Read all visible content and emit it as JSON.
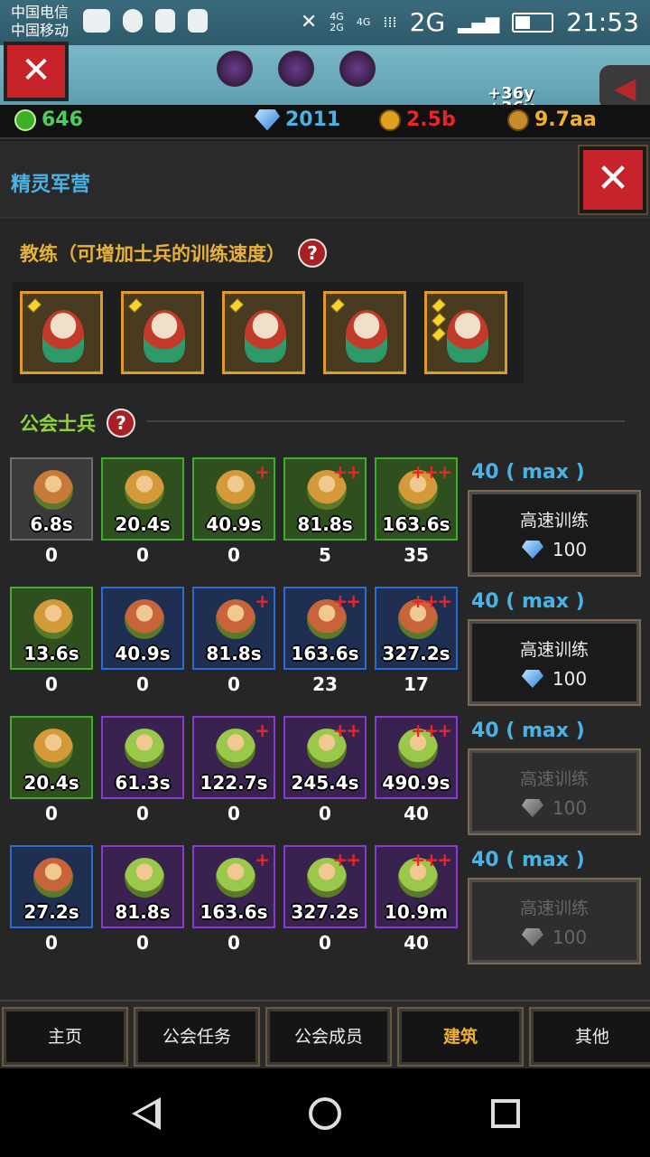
{
  "status_bar": {
    "carrier_1": "中国电信",
    "carrier_2": "中国移动",
    "network_4g_top": "4G",
    "network_4g_2g": "4G",
    "network_2g_small": "2G",
    "network_2g": "2G",
    "time": "21:53"
  },
  "resources": {
    "gems_green": "646",
    "diamonds": "2011",
    "medal": "2.5b",
    "coins": "9.7aa",
    "gain_1": "+36y",
    "gain_2": "+36y"
  },
  "panel": {
    "title": "精灵军营",
    "coach_section_title": "教练（可增加士兵的训练速度）",
    "guild_section_title": "公会士兵",
    "help_glyph": "?",
    "close_glyph": "✕"
  },
  "coaches": [
    {
      "gems": 1
    },
    {
      "gems": 1
    },
    {
      "gems": 1
    },
    {
      "gems": 1
    },
    {
      "gems": 3
    }
  ],
  "soldier_rows": [
    {
      "max_label": "40 ( max )",
      "train_label": "高速训练",
      "train_cost": "100",
      "enabled": true,
      "units": [
        {
          "time": "6.8s",
          "count": "0",
          "plus": "",
          "tier": "gray"
        },
        {
          "time": "20.4s",
          "count": "0",
          "plus": "",
          "tier": "green"
        },
        {
          "time": "40.9s",
          "count": "0",
          "plus": "+",
          "tier": "green"
        },
        {
          "time": "81.8s",
          "count": "5",
          "plus": "++",
          "tier": "green"
        },
        {
          "time": "163.6s",
          "count": "35",
          "plus": "+++",
          "tier": "green"
        }
      ]
    },
    {
      "max_label": "40 ( max )",
      "train_label": "高速训练",
      "train_cost": "100",
      "enabled": true,
      "units": [
        {
          "time": "13.6s",
          "count": "0",
          "plus": "",
          "tier": "green"
        },
        {
          "time": "40.9s",
          "count": "0",
          "plus": "",
          "tier": "blue"
        },
        {
          "time": "81.8s",
          "count": "0",
          "plus": "+",
          "tier": "blue"
        },
        {
          "time": "163.6s",
          "count": "23",
          "plus": "++",
          "tier": "blue"
        },
        {
          "time": "327.2s",
          "count": "17",
          "plus": "+++",
          "tier": "blue"
        }
      ]
    },
    {
      "max_label": "40 ( max )",
      "train_label": "高速训练",
      "train_cost": "100",
      "enabled": false,
      "units": [
        {
          "time": "20.4s",
          "count": "0",
          "plus": "",
          "tier": "green"
        },
        {
          "time": "61.3s",
          "count": "0",
          "plus": "",
          "tier": "purple"
        },
        {
          "time": "122.7s",
          "count": "0",
          "plus": "+",
          "tier": "purple"
        },
        {
          "time": "245.4s",
          "count": "0",
          "plus": "++",
          "tier": "purple"
        },
        {
          "time": "490.9s",
          "count": "40",
          "plus": "+++",
          "tier": "purple"
        }
      ]
    },
    {
      "max_label": "40 ( max )",
      "train_label": "高速训练",
      "train_cost": "100",
      "enabled": false,
      "units": [
        {
          "time": "27.2s",
          "count": "0",
          "plus": "",
          "tier": "blue"
        },
        {
          "time": "81.8s",
          "count": "0",
          "plus": "",
          "tier": "purple"
        },
        {
          "time": "163.6s",
          "count": "0",
          "plus": "+",
          "tier": "purple"
        },
        {
          "time": "327.2s",
          "count": "0",
          "plus": "++",
          "tier": "purple"
        },
        {
          "time": "10.9m",
          "count": "40",
          "plus": "+++",
          "tier": "purple"
        }
      ]
    }
  ],
  "tabs": [
    {
      "label": "主页",
      "active": false
    },
    {
      "label": "公会任务",
      "active": false
    },
    {
      "label": "公会成员",
      "active": false
    },
    {
      "label": "建筑",
      "active": true
    },
    {
      "label": "其他",
      "active": false
    }
  ],
  "colors": {
    "accent_blue": "#4ab3e6",
    "gold_title": "#e8b23a",
    "green_title": "#8ed43a",
    "close_red": "#c6242a",
    "medal_red": "#e8262a",
    "coin_gold": "#f0b030"
  },
  "icons": {
    "back_arrow": "◀",
    "close": "✕"
  }
}
